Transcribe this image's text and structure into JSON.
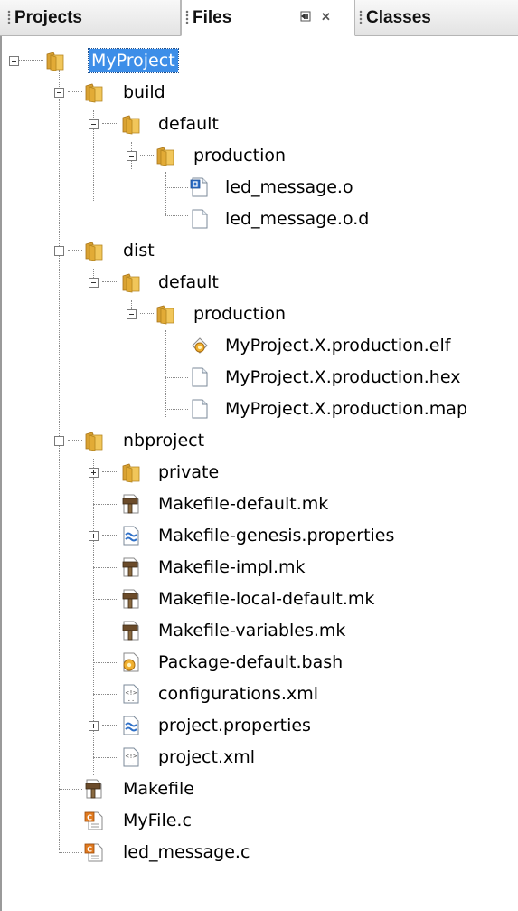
{
  "tabs": [
    {
      "label": "Projects",
      "active": false
    },
    {
      "label": "Files",
      "active": true
    },
    {
      "label": "Classes",
      "active": false
    }
  ],
  "tab_controls": {
    "minimize_icon": "minimize-icon",
    "close_glyph": "✕"
  },
  "tree": {
    "root": {
      "label": "MyProject",
      "selected": true
    },
    "build": {
      "label": "build"
    },
    "build_default": {
      "label": "default"
    },
    "build_production": {
      "label": "production"
    },
    "led_message_o": {
      "label": "led_message.o"
    },
    "led_message_o_d": {
      "label": "led_message.o.d"
    },
    "dist": {
      "label": "dist"
    },
    "dist_default": {
      "label": "default"
    },
    "dist_production": {
      "label": "production"
    },
    "elf": {
      "label": "MyProject.X.production.elf"
    },
    "hex": {
      "label": "MyProject.X.production.hex"
    },
    "map": {
      "label": "MyProject.X.production.map"
    },
    "nbproject": {
      "label": "nbproject"
    },
    "private": {
      "label": "private"
    },
    "mk_default": {
      "label": "Makefile-default.mk"
    },
    "mk_genesis": {
      "label": "Makefile-genesis.properties"
    },
    "mk_impl": {
      "label": "Makefile-impl.mk"
    },
    "mk_local": {
      "label": "Makefile-local-default.mk"
    },
    "mk_variables": {
      "label": "Makefile-variables.mk"
    },
    "pkg_bash": {
      "label": "Package-default.bash"
    },
    "config_xml": {
      "label": "configurations.xml"
    },
    "project_props": {
      "label": "project.properties"
    },
    "project_xml": {
      "label": "project.xml"
    },
    "makefile": {
      "label": "Makefile"
    },
    "myfile_c": {
      "label": "MyFile.c"
    },
    "led_message_c": {
      "label": "led_message.c"
    }
  },
  "colors": {
    "selection": "#3d8ee8",
    "folder": "#e8b84a",
    "c_file": "#e07a1f"
  }
}
